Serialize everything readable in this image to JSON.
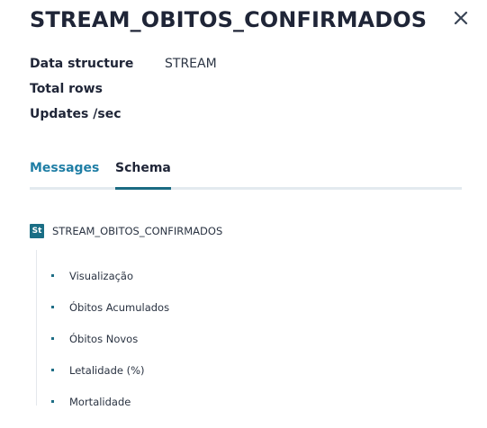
{
  "header": {
    "title": "STREAM_OBITOS_CONFIRMADOS",
    "close_icon": "close-icon"
  },
  "meta": [
    {
      "label": "Data structure",
      "value": "STREAM"
    },
    {
      "label": "Total rows",
      "value": ""
    },
    {
      "label": "Updates /sec",
      "value": ""
    }
  ],
  "tabs": [
    {
      "label": "Messages",
      "active": false
    },
    {
      "label": "Schema",
      "active": true
    }
  ],
  "schema": {
    "badge": "St",
    "name": "STREAM_OBITOS_CONFIRMADOS",
    "fields": [
      {
        "name": "Visualização"
      },
      {
        "name": "Óbitos Acumulados"
      },
      {
        "name": "Óbitos Novos"
      },
      {
        "name": "Letalidade (%)"
      },
      {
        "name": "Mortalidade"
      }
    ]
  },
  "colors": {
    "accent": "#1f7ea5",
    "badge": "#1a6e85",
    "title": "#1f2537"
  }
}
